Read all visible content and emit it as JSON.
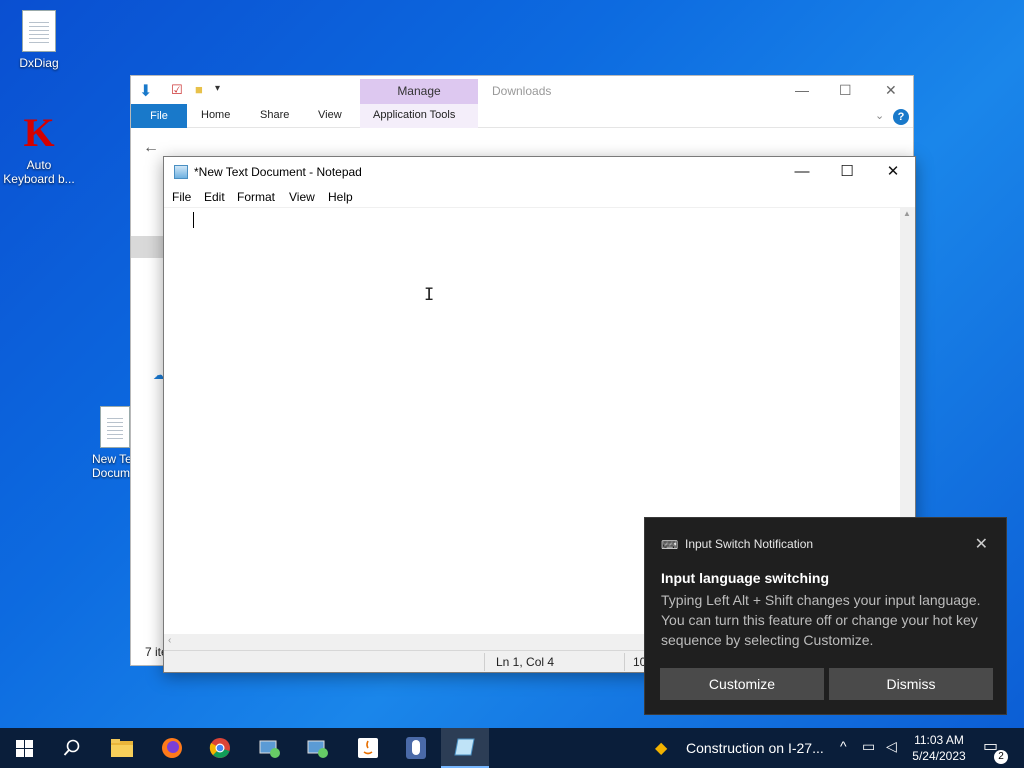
{
  "desktop": {
    "icons": [
      {
        "label": "DxDiag"
      },
      {
        "label": "Auto Keyboard b..."
      },
      {
        "label": "New Te Docum"
      }
    ]
  },
  "explorer": {
    "manage_tab": "Manage",
    "window_title": "Downloads",
    "ribbon_tabs": [
      "File",
      "Home",
      "Share",
      "View",
      "Application Tools"
    ],
    "status": "7 ite"
  },
  "notepad": {
    "title": "*New Text Document - Notepad",
    "menu": [
      "File",
      "Edit",
      "Format",
      "View",
      "Help"
    ],
    "content": "",
    "status_position": "Ln 1, Col 4",
    "status_zoom": "10"
  },
  "toast": {
    "app_name": "Input Switch Notification",
    "heading": "Input language switching",
    "body": "Typing Left Alt + Shift changes your input language. You can turn this feature off or change your hot key sequence by selecting Customize.",
    "customize_label": "Customize",
    "dismiss_label": "Dismiss"
  },
  "taskbar": {
    "weather": "Construction on I-27...",
    "time": "11:03 AM",
    "date": "5/24/2023",
    "notification_count": "2",
    "icons": [
      "start-icon",
      "search-icon",
      "file-explorer-icon",
      "firefox-icon",
      "chrome-icon",
      "app-icon",
      "app-icon",
      "java-icon",
      "mouse-icon",
      "notepad-icon"
    ]
  },
  "colors": {
    "accent": "#1979ca",
    "manage": "#ddc8f0",
    "toast_bg": "#1f1f1f",
    "taskbar_bg": "#0a1e3a"
  }
}
